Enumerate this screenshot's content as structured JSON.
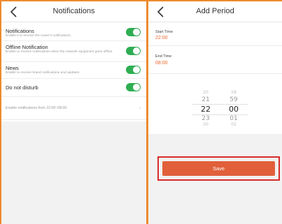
{
  "left": {
    "title": "Notifications",
    "items": [
      {
        "title": "Notifications",
        "desc": "Enable it to receive the router's notifications.",
        "on": true
      },
      {
        "title": "Offline Notification",
        "desc": "Enable to receive notifications when the network equipment goes offline.",
        "on": true
      },
      {
        "title": "News",
        "desc": "Enable to receive brand notifications and updates.",
        "on": true
      },
      {
        "title": "Do not disturb",
        "on": true
      }
    ],
    "dnd_period": "Enable notifications from 22:00~08:00."
  },
  "right": {
    "title": "Add Period",
    "start_label": "Start Time",
    "start_value": "22:00",
    "end_label": "End Time",
    "end_value": "08:00",
    "picker": {
      "hours": [
        "20",
        "21",
        "22",
        "23",
        "00"
      ],
      "minutes": [
        "58",
        "59",
        "00",
        "01",
        "02"
      ]
    },
    "save_label": "Save"
  },
  "colors": {
    "accent_orange": "#e8692e",
    "toggle_green": "#2eae52",
    "frame_orange": "#ee8a2e",
    "highlight_red": "#d92b2b"
  }
}
